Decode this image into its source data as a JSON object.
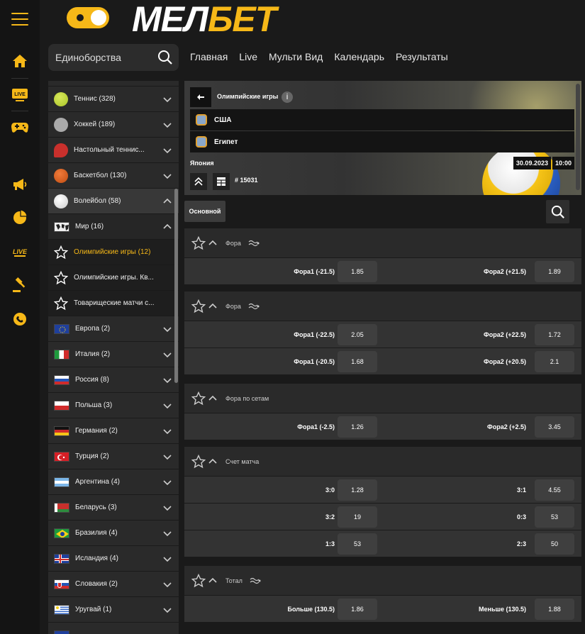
{
  "brand": {
    "logo_white": "МЕЛ",
    "logo_yellow": "БЕТ",
    "accent": "#f6b818"
  },
  "rail": {
    "icons": [
      "menu-icon",
      "home-icon",
      "live-icon",
      "gamepad-icon",
      "megaphone-icon",
      "pie-chart-icon",
      "live-casino-icon",
      "auction-icon",
      "support-chat-icon"
    ]
  },
  "search": {
    "value": "Единоборства"
  },
  "nav": {
    "items": [
      "Главная",
      "Live",
      "Мульти Вид",
      "Календарь",
      "Результаты"
    ]
  },
  "sports": {
    "items": [
      {
        "label": "Теннис (328)"
      },
      {
        "label": "Хоккей (189)"
      },
      {
        "label": "Настольный теннис..."
      },
      {
        "label": "Баскетбол (130)"
      },
      {
        "label": "Волейбол (58)"
      },
      {
        "label": "Мир (16)"
      },
      {
        "label": "Олимпийские игры (12)"
      },
      {
        "label": "Олимпийские игры. Кв..."
      },
      {
        "label": "Товарищеские матчи с..."
      },
      {
        "label": "Европа (2)"
      },
      {
        "label": "Италия (2)"
      },
      {
        "label": "Россия (8)"
      },
      {
        "label": "Польша (3)"
      },
      {
        "label": "Германия (2)"
      },
      {
        "label": "Турция (2)"
      },
      {
        "label": "Аргентина (4)"
      },
      {
        "label": "Беларусь (3)"
      },
      {
        "label": "Бразилия (4)"
      },
      {
        "label": "Исландия (4)"
      },
      {
        "label": "Словакия (2)"
      },
      {
        "label": "Уругвай (1)"
      }
    ]
  },
  "event": {
    "championship": "Олимпийские игры",
    "team1": "США",
    "team2": "Египет",
    "country": "Япония",
    "event_id": "# 15031",
    "date": "30.09.2023",
    "time": "10:00",
    "info_glyph": "i"
  },
  "tabs": {
    "main": "Основной"
  },
  "markets": [
    {
      "title": "Фора",
      "rows": [
        {
          "l1": "Фора1 (-21.5)",
          "o1": "1.85",
          "l2": "Фора2 (+21.5)",
          "o2": "1.89"
        }
      ]
    },
    {
      "title": "Фора",
      "rows": [
        {
          "l1": "Фора1 (-22.5)",
          "o1": "2.05",
          "l2": "Фора2 (+22.5)",
          "o2": "1.72"
        },
        {
          "l1": "Фора1 (-20.5)",
          "o1": "1.68",
          "l2": "Фора2 (+20.5)",
          "o2": "2.1"
        }
      ]
    },
    {
      "title": "Фора по сетам",
      "rows": [
        {
          "l1": "Фора1 (-2.5)",
          "o1": "1.26",
          "l2": "Фора2 (+2.5)",
          "o2": "3.45"
        }
      ]
    },
    {
      "title": "Счет матча",
      "rows": [
        {
          "l1": "3:0",
          "o1": "1.28",
          "l2": "3:1",
          "o2": "4.55"
        },
        {
          "l1": "3:2",
          "o1": "19",
          "l2": "0:3",
          "o2": "53"
        },
        {
          "l1": "1:3",
          "o1": "53",
          "l2": "2:3",
          "o2": "50"
        }
      ]
    },
    {
      "title": "Тотал",
      "rows": [
        {
          "l1": "Больше (130.5)",
          "o1": "1.86",
          "l2": "Меньше (130.5)",
          "o2": "1.88"
        }
      ]
    }
  ]
}
